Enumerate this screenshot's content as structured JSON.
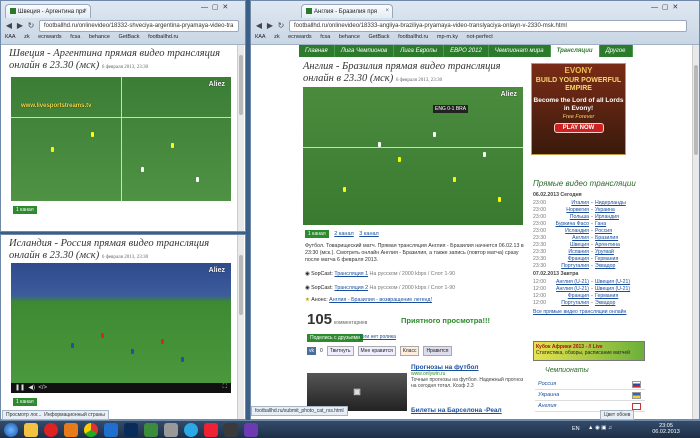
{
  "left_top_window": {
    "tab_title": "Швеция - Аргентина пря",
    "url": "footballhd.ru/onlinevideo/18332-shveciya-argentina-pryamaya-video-tra",
    "bookmarks": [
      "КАА",
      "zk",
      "ecnwards",
      "fcsa",
      "behance",
      "GetBack",
      "footballhd.ru"
    ],
    "page_title": "Швеция - Аргентина прямая видео трансляция онлайн в 23.30 (мск)",
    "date": "6 февраля 2013, 23:30",
    "video_watermark": "www.livesportstreams.tv",
    "video_logo": "Aliez",
    "channel_tag": "1 канал"
  },
  "left_bottom_window": {
    "page_title": "Исландия - Россия прямая видео трансляция онлайн в 23.30 (мск)",
    "date": "6 февраля 2013, 23:30",
    "video_logo": "Aliez"
  },
  "right_window": {
    "tab_title": "Англия - Бразилия пря",
    "url": "footballhd.ru/onlinevideo/18333-angliya-braziliya-pryamaya-video-translyaciya-onlayn-v-2330-msk.html",
    "bookmarks": [
      "КАА",
      "zk",
      "ecnwards",
      "fcsa",
      "behance",
      "GetBack",
      "footballhd.ru",
      "mp-m.ky",
      "not-perfect"
    ],
    "menu": [
      "Главная",
      "Лига Чемпионов",
      "Лига Европы",
      "ЕВРО 2012",
      "Чемпионат мира",
      "Трансляции",
      "Другое"
    ],
    "menu_active": 5,
    "page_title": "Англия - Бразилия прямая видео трансляция онлайн в 23.30 (мск)",
    "date": "6 февраля 2013, 23:30",
    "video_logo": "Aliez",
    "score": "ENG 0-1 BRA",
    "channel_tags": [
      "1 канал",
      "2 канал",
      "3 канал"
    ],
    "description": "Футбол. Товарищеский матч. Прямая трансляция Англия - Бразилия начнется 06.02.13 в 23:30 (мск.). Смотреть онлайн Англия - Бразилия, а также запись (повтор матча) сразу после матча 6 февраля 2013.",
    "sopcast_1_label": "SopCast:",
    "sopcast_1_link": "Трансляция 1",
    "sopcast_1_note": "На русском / 2000 kbps / Слот 1-90",
    "sopcast_2_label": "SopCast:",
    "sopcast_2_link": "Трансляция 2",
    "sopcast_2_note": "На русском / 2000 kbps / Слот 1-90",
    "anons_label": "Анонс:",
    "anons_link": "Англия - Бразилия - возвращение легенд!",
    "comments_count": "105",
    "comments_label": "комментариев",
    "enjoy_text": "Приятного просмотра!!!",
    "share_label": "Поделись с друзьями",
    "tags_label": "Тэги нет ролика",
    "like_count": "0",
    "social": [
      "Твитнуть",
      "Мне нравится",
      "Класс",
      "Нравится"
    ],
    "ad": {
      "brand": "EVONY",
      "line1": "BUILD YOUR POWERFUL EMPIRE",
      "line2": "Become the Lord of all Lords in Evony!",
      "line3": "Free Forever",
      "cta": "PLAY NOW"
    },
    "schedule_title": "Прямые видео трансляции",
    "schedule_day1": "06.02.2013 Сегодня",
    "schedule": [
      {
        "time": "23:00",
        "home": "Италия",
        "away": "Нидерланды"
      },
      {
        "time": "23:00",
        "home": "Норвегия",
        "away": "Украина"
      },
      {
        "time": "23:00",
        "home": "Польша",
        "away": "Ирландия"
      },
      {
        "time": "23:00",
        "home": "Буркина Фасо",
        "away": "Гана"
      },
      {
        "time": "23:00",
        "home": "Исландия",
        "away": "Россия"
      },
      {
        "time": "23:30",
        "home": "Англия",
        "away": "Бразилия"
      },
      {
        "time": "23:30",
        "home": "Швеция",
        "away": "Аргентина"
      },
      {
        "time": "23:30",
        "home": "Испания",
        "away": "Уругвай"
      },
      {
        "time": "23:30",
        "home": "Франция",
        "away": "Германия"
      },
      {
        "time": "23:30",
        "home": "Португалия",
        "away": "Эквадор"
      }
    ],
    "schedule_day2": "07.02.2013 Завтра",
    "schedule2": [
      {
        "time": "12:00",
        "home": "Англия (U-21)",
        "away": "Швеция (U-21)"
      },
      {
        "time": "12:00",
        "home": "Англия (U-21)",
        "away": "Швеция (U-21)"
      },
      {
        "time": "12:00",
        "home": "Франция",
        "away": "Германия"
      },
      {
        "time": "12:00",
        "home": "Португалия",
        "away": "Эквадор"
      }
    ],
    "all_link": "Все прямые видео трансляции онлайн",
    "cup_banner": "Кубок Африки 2013 - // Live",
    "cup_sub": "Статистика, обзоры, расписание матчей",
    "news1_title": "Прогнозы на футбол",
    "news1_site": "www.onlywin.ru",
    "news1_text": "Точные прогнозы на футбол. Надежный прогноз на сегодня тотал. Коэф 2.3",
    "news2_title": "Билеты на Барселона -Реал",
    "champions_title": "Чемпионаты",
    "champions": [
      "Россия",
      "Украина",
      "Англия"
    ],
    "status_url": "footballhd.ru/submit_photo_cat_rss.html"
  },
  "taskbar": {
    "lang": "EN",
    "time": "23:05",
    "date": "06.02.2013",
    "status_left": "Просмотр лог...",
    "status_left2": "Информационный страны",
    "status_right": "Цвет обоев"
  }
}
